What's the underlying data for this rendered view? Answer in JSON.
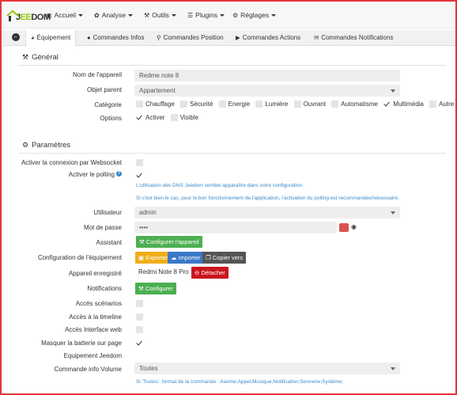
{
  "navbar": {
    "logo_text": "JEEDOM",
    "items": [
      {
        "label": "Accueil",
        "icon": "dashboard-icon"
      },
      {
        "label": "Analyse",
        "icon": "stethoscope-icon"
      },
      {
        "label": "Outils",
        "icon": "wrench-icon"
      },
      {
        "label": "Plugins",
        "icon": "tasks-icon"
      },
      {
        "label": "Réglages",
        "icon": "gears-icon"
      }
    ]
  },
  "tabs": {
    "items": [
      {
        "label": "Équipement",
        "icon": "tachometer-icon",
        "active": true
      },
      {
        "label": "Commandes Infos",
        "icon": "list-icon"
      },
      {
        "label": "Commandes Position",
        "icon": "map-marker-icon"
      },
      {
        "label": "Commandes Actions",
        "icon": "play-circle-icon"
      },
      {
        "label": "Commandes Notifications",
        "icon": "comment-icon"
      }
    ]
  },
  "general": {
    "title": "Général",
    "device_name_label": "Nom de l'appareil",
    "device_name_placeholder": "Redme note 8",
    "parent_label": "Objet parent",
    "parent_value": "Appartement",
    "category_label": "Catégorie",
    "categories": [
      {
        "label": "Chauffage",
        "checked": false
      },
      {
        "label": "Sécurité",
        "checked": false
      },
      {
        "label": "Energie",
        "checked": false
      },
      {
        "label": "Lumière",
        "checked": false
      },
      {
        "label": "Ouvrant",
        "checked": false
      },
      {
        "label": "Automatisme",
        "checked": false
      },
      {
        "label": "Multimédia",
        "checked": true
      },
      {
        "label": "Autre",
        "checked": false
      }
    ],
    "options_label": "Options",
    "options": [
      {
        "label": "Activer",
        "checked": true
      },
      {
        "label": "Visible",
        "checked": false
      }
    ]
  },
  "params": {
    "title": "Paramètres",
    "websocket_label": "Activer la connexion par Websocket",
    "websocket_checked": false,
    "polling_label": "Activer le polling",
    "polling_help": "?",
    "polling_checked": true,
    "polling_note_1": "L'utilisation des DNS Jeedom semble apparaître dans votre configuration.",
    "polling_note_2": "Si c'est bien le cas, pour le bon fonctionnement de l'application, l'activation du polling est recommandée/nécessaire.",
    "user_label": "Utilisateur",
    "user_value": "admin",
    "password_label": "Mot de passe",
    "password_value": "••••",
    "assistant_label": "Assistant",
    "configure_device_button": "Configurer l'appareil",
    "config_label": "Configuration de l'équipement",
    "export_button": "Exporter",
    "import_button": "Importer",
    "copy_button": "Copier vers",
    "registered_label": "Appareil enregistré",
    "registered_value": "Redmi Note 8 Pro",
    "detach_button": "Détacher",
    "notifications_label": "Notifications",
    "configure_button": "Configurer",
    "scenarios_label": "Accès scénarios",
    "timeline_label": "Accès à la timeline",
    "web_label": "Accès Interface web",
    "battery_label": "Masquer la batterie sur page",
    "battery_checked": true,
    "jeedom_label": "Equipement Jeedom",
    "volume_label": "Commande info Volume",
    "volume_value": "Toutes",
    "volume_note": "Si 'Toutes', format de la commande : Alarme;Appel;Musique;Notification;Sonnerie;Système;"
  }
}
